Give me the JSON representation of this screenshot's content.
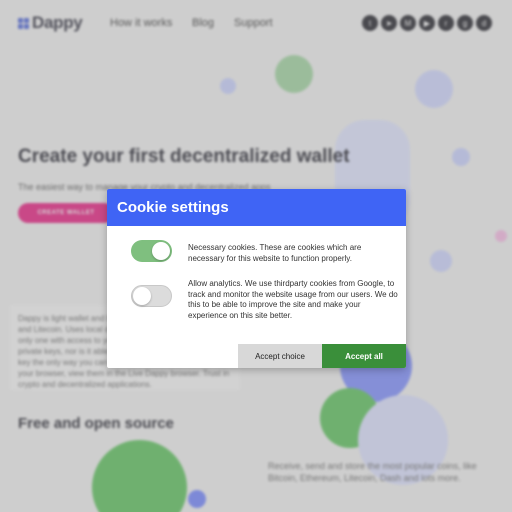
{
  "brand": {
    "name": "Dappy"
  },
  "nav": {
    "links": [
      "How it works",
      "Blog",
      "Support"
    ]
  },
  "socials": [
    {
      "icon": "twitter-icon",
      "glyph": "t"
    },
    {
      "icon": "telegram-icon",
      "glyph": "➤"
    },
    {
      "icon": "medium-icon",
      "glyph": "M"
    },
    {
      "icon": "youtube-icon",
      "glyph": "▶"
    },
    {
      "icon": "reddit-icon",
      "glyph": "r"
    },
    {
      "icon": "github-icon",
      "glyph": "g"
    },
    {
      "icon": "discord-icon",
      "glyph": "d"
    }
  ],
  "hero": {
    "title": "Create your first decentralized wallet",
    "subtitle": "The easiest way to manage your crypto and decentralized apps",
    "cta": "CREATE WALLET"
  },
  "card": {
    "text": "Dappy is light wallet and browser for Ethereum, Bitcoin, Dash and Litecoin. Uses local decentralized storage so you are the only one with access to your keys. Dappy does not store your private keys, nor is it able to access them. Store your private key the only way you can see it, send and receive coins in your browser, view them in the Live Dappy browser. Trust in crypto and decentralized applications."
  },
  "section": {
    "title": "Free and open source"
  },
  "right_text": "Receive, send and store the most popular coins, like Bitcoin, Ethereum, Litecoin, Dash and lots more.",
  "cookie_dialog": {
    "title": "Cookie settings",
    "options": [
      {
        "enabled": true,
        "text": "Necessary cookies. These are cookies which are necessary for this website to function properly."
      },
      {
        "enabled": false,
        "text": "Allow analytics. We use thirdparty cookies from Google, to track and monitor the website usage from our users. We do this to be able to improve the site and make your experience on this site better."
      }
    ],
    "buttons": {
      "accept_choice": "Accept choice",
      "accept_all": "Accept all"
    }
  },
  "colors": {
    "accent": "#3f64f5",
    "toggle_on": "#7fbf7f",
    "accept_all": "#3a8f3a",
    "cta": "#e8197f"
  }
}
